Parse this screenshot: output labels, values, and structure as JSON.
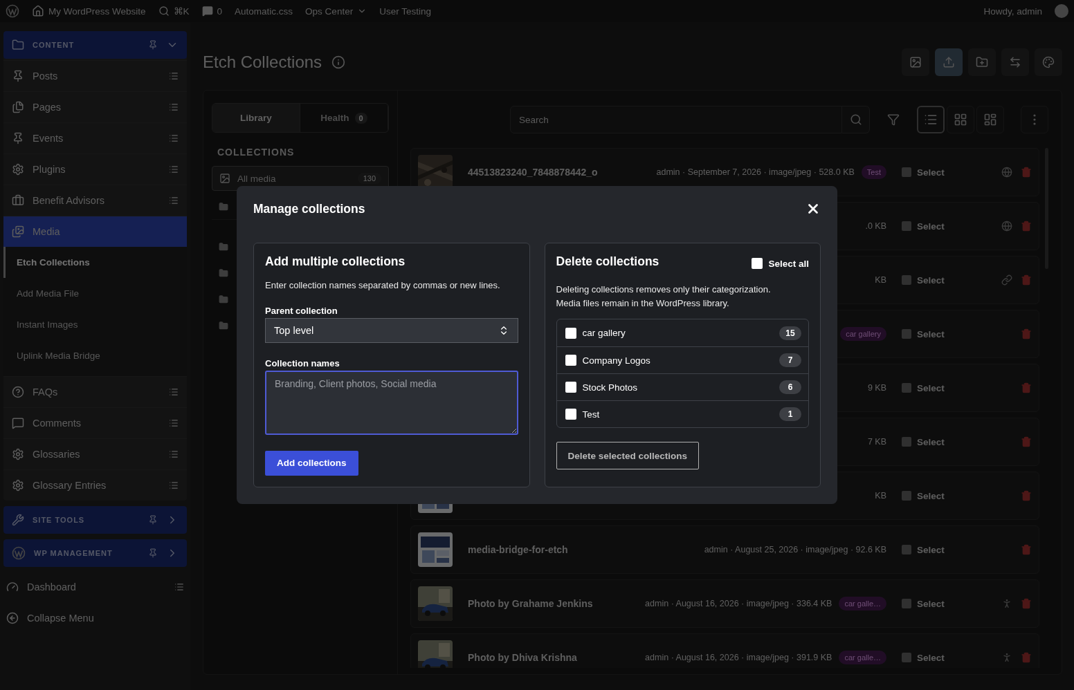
{
  "admin_bar": {
    "items": [
      {
        "kind": "site",
        "label": "My WordPress Website"
      },
      {
        "kind": "search",
        "label": "⌘K"
      },
      {
        "kind": "comments",
        "label": "0"
      },
      {
        "kind": "link",
        "label": "Automatic.css"
      },
      {
        "kind": "menu",
        "label": "Ops Center"
      },
      {
        "kind": "link",
        "label": "User Testing"
      }
    ],
    "greeting": "Howdy, admin"
  },
  "sidebar": {
    "groups": [
      {
        "kind": "section",
        "label": "CONTENT",
        "expanded": true,
        "items": [
          {
            "label": "Posts",
            "selected": false
          },
          {
            "label": "Pages",
            "selected": false
          },
          {
            "label": "Events",
            "selected": false
          },
          {
            "label": "Plugins",
            "selected": false
          },
          {
            "label": "Benefit Advisors",
            "selected": false
          },
          {
            "label": "Media",
            "selected": true,
            "children": [
              {
                "label": "Etch Collections",
                "selected": true
              },
              {
                "label": "Add Media File",
                "selected": false
              },
              {
                "label": "Instant Images",
                "selected": false
              },
              {
                "label": "Uplink Media Bridge",
                "selected": false
              }
            ]
          },
          {
            "label": "FAQs",
            "selected": false
          },
          {
            "label": "Comments",
            "selected": false
          },
          {
            "label": "Glossaries",
            "selected": false
          },
          {
            "label": "Glossary Entries",
            "selected": false
          }
        ]
      },
      {
        "kind": "section",
        "label": "SITE TOOLS",
        "expanded": false
      },
      {
        "kind": "section",
        "label": "WP MANAGEMENT",
        "expanded": false
      },
      {
        "kind": "link",
        "label": "Dashboard"
      },
      {
        "kind": "link",
        "label": "Collapse Menu"
      }
    ]
  },
  "page": {
    "title": "Etch Collections",
    "toolbar": [
      {
        "selected": false
      },
      {
        "selected": true
      },
      {
        "selected": false
      },
      {
        "selected": false
      },
      {
        "selected": false
      }
    ]
  },
  "library": {
    "tabs": [
      {
        "label": "Library",
        "selected": true
      },
      {
        "label": "Health",
        "badge": "0",
        "selected": false
      }
    ],
    "heading": "COLLECTIONS",
    "collections": [
      {
        "kind": "all",
        "label": "All media",
        "count": "130",
        "selected": true
      },
      {
        "kind": "folder"
      },
      {
        "kind": "folder"
      },
      {
        "kind": "folder"
      },
      {
        "kind": "folder"
      },
      {
        "kind": "folder"
      }
    ]
  },
  "media": {
    "search": {
      "placeholder": "Search"
    },
    "views": [
      {
        "selected": true
      },
      {
        "selected": false
      },
      {
        "selected": false
      }
    ],
    "rows": [
      {
        "name": "44513823240_7848878442_o",
        "meta": "admin · September 7, 2026 · image/jpeg · 528.0 KB",
        "tag": "Test",
        "select": "Select",
        "checked": false
      },
      {
        "meta": ".0 KB",
        "select": "Select",
        "checked": false
      },
      {
        "meta": "KB",
        "select": "Select",
        "checked": false
      },
      {
        "tag": "car gallery",
        "select": "Select",
        "checked": false
      },
      {
        "meta": "9 KB",
        "select": "Select",
        "checked": false
      },
      {
        "meta": "7 KB",
        "select": "Select",
        "checked": false
      },
      {
        "meta": "KB",
        "select": "Select",
        "checked": false
      },
      {
        "name": "media-bridge-for-etch",
        "meta": "admin · August 25, 2026 · image/jpeg · 92.6 KB",
        "select": "Select",
        "checked": false
      },
      {
        "name": "Photo by Grahame Jenkins",
        "meta": "admin · August 16, 2026 · image/jpeg · 336.4 KB",
        "tag": "car galle…",
        "select": "Select",
        "checked": false
      },
      {
        "name": "Photo by Dhiva Krishna",
        "meta": "admin · August 16, 2026 · image/jpeg · 391.9 KB",
        "tag": "car galle…",
        "select": "Select",
        "checked": false
      }
    ]
  },
  "modal": {
    "title": "Manage collections",
    "add": {
      "heading": "Add multiple collections",
      "hint": "Enter collection names separated by commas or new lines.",
      "parent_label": "Parent collection",
      "parent_value": "Top level",
      "names_label": "Collection names",
      "names_placeholder": "Branding, Client photos, Social media",
      "button": "Add collections"
    },
    "delete": {
      "heading": "Delete collections",
      "select_all": {
        "label": "Select all",
        "checked": false
      },
      "note_lines": [
        "Deleting collections removes only their categorization.",
        "Media files remain in the WordPress library."
      ],
      "collections": [
        {
          "label": "car gallery",
          "count": "15",
          "checked": false
        },
        {
          "label": "Company Logos",
          "count": "7",
          "checked": false
        },
        {
          "label": "Stock Photos",
          "count": "6",
          "checked": false
        },
        {
          "label": "Test",
          "count": "1",
          "checked": false
        }
      ],
      "button": "Delete selected collections"
    }
  }
}
